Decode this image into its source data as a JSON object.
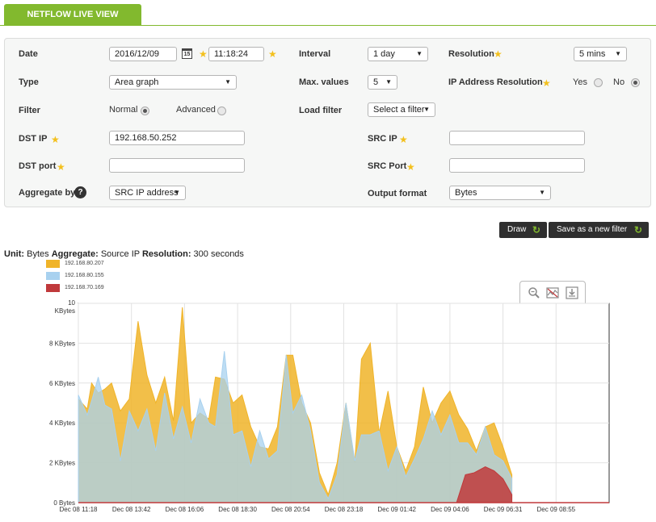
{
  "tab": {
    "label": "NETFLOW LIVE VIEW"
  },
  "filter": {
    "date": {
      "label": "Date",
      "value": "2016/12/09",
      "calendar_icon_text": "15"
    },
    "time": {
      "value": "11:18:24"
    },
    "interval": {
      "label": "Interval",
      "value": "1 day"
    },
    "resolution": {
      "label": "Resolution",
      "value": "5 mins"
    },
    "type": {
      "label": "Type",
      "value": "Area graph"
    },
    "max_values": {
      "label": "Max. values",
      "value": "5"
    },
    "ip_resolution": {
      "label": "IP Address Resolution",
      "yes": "Yes",
      "no": "No",
      "selected": "No"
    },
    "filter_mode": {
      "label": "Filter",
      "normal": "Normal",
      "advanced": "Advanced",
      "selected": "Normal"
    },
    "load_filter": {
      "label": "Load filter",
      "value": "Select a filter"
    },
    "dst_ip": {
      "label": "DST IP",
      "value": "192.168.50.252"
    },
    "src_ip": {
      "label": "SRC IP",
      "value": ""
    },
    "dst_port": {
      "label": "DST port",
      "value": ""
    },
    "src_port": {
      "label": "SRC Port",
      "value": ""
    },
    "aggregate": {
      "label": "Aggregate by",
      "value": "SRC IP address",
      "help": "?"
    },
    "output_format": {
      "label": "Output format",
      "value": "Bytes"
    }
  },
  "buttons": {
    "draw": "Draw",
    "save_filter": "Save as a new filter",
    "icon": "refresh-icon"
  },
  "summary": {
    "unit_label": "Unit:",
    "unit_value": "Bytes",
    "aggregate_label": "Aggregate:",
    "aggregate_value": "Source IP",
    "resolution_label": "Resolution:",
    "resolution_value": "300 seconds"
  },
  "graph_tools": [
    "zoom-icon",
    "chart-reset-icon",
    "chart-export-icon"
  ],
  "colors": {
    "accent": "#82b92e",
    "series1": "#f0b429",
    "series2": "#a8d1ef",
    "series3": "#c0393b"
  },
  "chart_data": {
    "type": "area",
    "title": "",
    "xlabel": "",
    "ylabel": "",
    "ylim": [
      0,
      10
    ],
    "y_ticks": [
      {
        "v": 0,
        "label": "0 Bytes"
      },
      {
        "v": 2,
        "label": "2 KBytes"
      },
      {
        "v": 4,
        "label": "4 KBytes"
      },
      {
        "v": 6,
        "label": "6 KBytes"
      },
      {
        "v": 8,
        "label": "8 KBytes"
      },
      {
        "v": 10,
        "label": "10 KBytes"
      }
    ],
    "x_tick_labels": [
      "Dec 08 11:18",
      "Dec 08 13:42",
      "Dec 08 16:06",
      "Dec 08 18:30",
      "Dec 08 20:54",
      "Dec 08 23:18",
      "Dec 09 01:42",
      "Dec 09 04:06",
      "Dec 09 06:31",
      "Dec 09 08:55"
    ],
    "x_range_hours": [
      0,
      24
    ],
    "grid": true,
    "legend_position": "top-left",
    "series": [
      {
        "name": "192.168.80.207",
        "color": "#f0b429",
        "points": [
          [
            0,
            5.2
          ],
          [
            0.4,
            4.7
          ],
          [
            0.6,
            6.0
          ],
          [
            0.9,
            5.5
          ],
          [
            1.2,
            5.7
          ],
          [
            1.5,
            6.0
          ],
          [
            1.9,
            4.6
          ],
          [
            2.3,
            5.2
          ],
          [
            2.7,
            9.1
          ],
          [
            3.1,
            6.4
          ],
          [
            3.5,
            5.0
          ],
          [
            3.9,
            6.3
          ],
          [
            4.3,
            4.1
          ],
          [
            4.7,
            9.8
          ],
          [
            5.1,
            4.0
          ],
          [
            5.5,
            4.5
          ],
          [
            5.9,
            4.2
          ],
          [
            6.2,
            6.3
          ],
          [
            6.6,
            6.2
          ],
          [
            7.0,
            5.0
          ],
          [
            7.4,
            5.4
          ],
          [
            7.8,
            3.8
          ],
          [
            8.2,
            2.8
          ],
          [
            8.6,
            2.7
          ],
          [
            9.0,
            3.8
          ],
          [
            9.4,
            7.4
          ],
          [
            9.7,
            7.4
          ],
          [
            10.1,
            5.0
          ],
          [
            10.5,
            4.0
          ],
          [
            10.9,
            1.5
          ],
          [
            11.3,
            0.4
          ],
          [
            11.7,
            2.0
          ],
          [
            12.1,
            5.0
          ],
          [
            12.5,
            2.0
          ],
          [
            12.8,
            7.2
          ],
          [
            13.2,
            8.0
          ],
          [
            13.6,
            3.5
          ],
          [
            14.0,
            5.6
          ],
          [
            14.4,
            2.8
          ],
          [
            14.8,
            1.6
          ],
          [
            15.2,
            2.8
          ],
          [
            15.6,
            5.8
          ],
          [
            16.0,
            4.0
          ],
          [
            16.4,
            5.0
          ],
          [
            16.8,
            5.6
          ],
          [
            17.2,
            4.4
          ],
          [
            17.6,
            3.7
          ],
          [
            18.0,
            2.6
          ],
          [
            18.4,
            3.8
          ],
          [
            18.8,
            4.0
          ],
          [
            19.2,
            2.8
          ],
          [
            19.6,
            1.4
          ]
        ]
      },
      {
        "name": "192.168.80.155",
        "color": "#a8d1ef",
        "points": [
          [
            0,
            5.4
          ],
          [
            0.4,
            4.4
          ],
          [
            0.6,
            5.1
          ],
          [
            0.9,
            6.3
          ],
          [
            1.2,
            4.9
          ],
          [
            1.5,
            4.7
          ],
          [
            1.9,
            2.1
          ],
          [
            2.3,
            4.6
          ],
          [
            2.7,
            3.6
          ],
          [
            3.1,
            4.7
          ],
          [
            3.5,
            2.6
          ],
          [
            3.9,
            5.5
          ],
          [
            4.3,
            3.2
          ],
          [
            4.7,
            4.8
          ],
          [
            5.1,
            3.0
          ],
          [
            5.5,
            5.2
          ],
          [
            5.9,
            4.0
          ],
          [
            6.2,
            3.8
          ],
          [
            6.6,
            7.6
          ],
          [
            7.0,
            3.4
          ],
          [
            7.4,
            3.6
          ],
          [
            7.8,
            1.8
          ],
          [
            8.2,
            3.6
          ],
          [
            8.6,
            2.2
          ],
          [
            9.0,
            2.6
          ],
          [
            9.4,
            7.4
          ],
          [
            9.7,
            4.5
          ],
          [
            10.1,
            5.4
          ],
          [
            10.5,
            3.6
          ],
          [
            10.9,
            1.0
          ],
          [
            11.3,
            0.2
          ],
          [
            11.7,
            1.4
          ],
          [
            12.1,
            5.0
          ],
          [
            12.5,
            2.1
          ],
          [
            12.8,
            3.4
          ],
          [
            13.2,
            3.4
          ],
          [
            13.6,
            3.6
          ],
          [
            14.0,
            1.6
          ],
          [
            14.4,
            2.8
          ],
          [
            14.8,
            1.3
          ],
          [
            15.2,
            2.2
          ],
          [
            15.6,
            3.2
          ],
          [
            16.0,
            4.6
          ],
          [
            16.4,
            3.4
          ],
          [
            16.8,
            4.4
          ],
          [
            17.2,
            3.0
          ],
          [
            17.6,
            3.0
          ],
          [
            18.0,
            2.4
          ],
          [
            18.4,
            3.8
          ],
          [
            18.8,
            2.4
          ],
          [
            19.2,
            2.1
          ],
          [
            19.6,
            1.2
          ]
        ]
      },
      {
        "name": "192.168.70.169",
        "color": "#c0393b",
        "points": [
          [
            0,
            0
          ],
          [
            17.1,
            0
          ],
          [
            17.5,
            1.4
          ],
          [
            17.9,
            1.5
          ],
          [
            18.4,
            1.8
          ],
          [
            18.8,
            1.6
          ],
          [
            19.2,
            1.2
          ],
          [
            19.6,
            0.4
          ]
        ]
      }
    ]
  }
}
